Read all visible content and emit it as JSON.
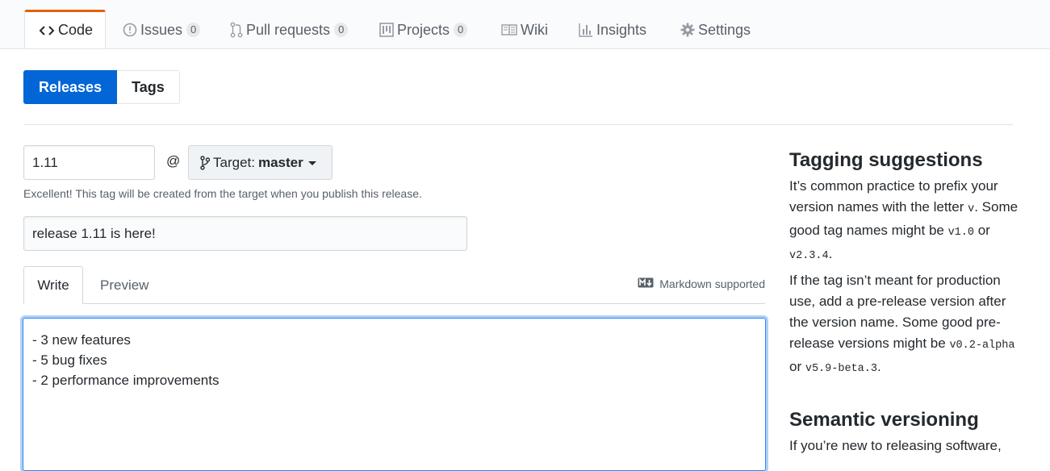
{
  "repo_nav": {
    "tabs": [
      {
        "label": "Code",
        "icon": "code-icon",
        "selected": true
      },
      {
        "label": "Issues",
        "icon": "issue-icon",
        "count": "0"
      },
      {
        "label": "Pull requests",
        "icon": "pull-request-icon",
        "count": "0"
      },
      {
        "label": "Projects",
        "icon": "project-icon",
        "count": "0"
      },
      {
        "label": "Wiki",
        "icon": "book-icon"
      },
      {
        "label": "Insights",
        "icon": "graph-icon"
      },
      {
        "label": "Settings",
        "icon": "gear-icon"
      }
    ]
  },
  "subnav": {
    "releases": "Releases",
    "tags": "Tags"
  },
  "form": {
    "tag_value": "1.11",
    "at_symbol": "@",
    "target_prefix": "Target:",
    "target_branch": "master",
    "tag_note": "Excellent! This tag will be created from the target when you publish this release.",
    "title_value": "release 1.11 is here!",
    "tabs": {
      "write": "Write",
      "preview": "Preview"
    },
    "markdown_note": "Markdown supported",
    "body_lines": [
      "- 3 new features",
      "- 5 bug fixes",
      "- 2 performance improvements"
    ]
  },
  "sidebar": {
    "heading1": "Tagging suggestions",
    "p1_text": "It’s common practice to prefix your version names with the letter ",
    "p1_code1": "v",
    "p1_text2": ". Some good tag names might be ",
    "p1_code2": "v1.0",
    "p1_or": " or ",
    "p1_code3": "v2.3.4",
    "p1_end": ".",
    "p2_text": "If the tag isn’t meant for production use, add a pre-release version after the version name. Some good pre-release versions might be ",
    "p2_code1": "v0.2-alpha",
    "p2_or": " or ",
    "p2_code2": "v5.9-beta.3",
    "p2_end": ".",
    "heading2": "Semantic versioning",
    "p3_text": "If you’re new to releasing software,"
  },
  "colors": {
    "accent": "#0366d6",
    "selected_tab_border": "#e36209",
    "focus_border": "#2188ff"
  }
}
